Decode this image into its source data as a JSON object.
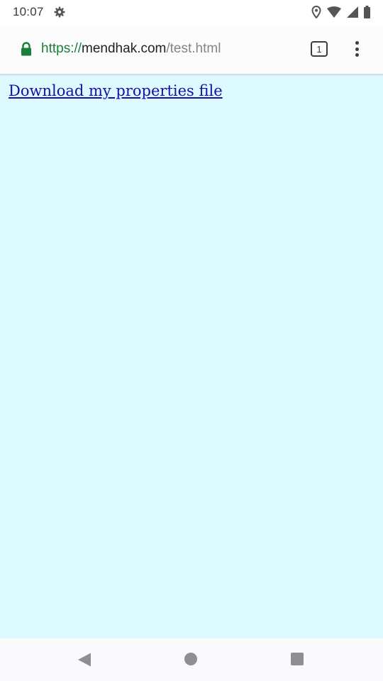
{
  "status_bar": {
    "time": "10:07",
    "icons": [
      "gear-icon",
      "location-icon",
      "wifi-icon",
      "cellular-signal-icon",
      "battery-icon"
    ]
  },
  "toolbar": {
    "url_scheme": "https://",
    "url_host": "mendhak.com",
    "url_path": "/test.html",
    "tab_count": "1",
    "secure_color": "#188038"
  },
  "page": {
    "link_text": "Download my properties file",
    "background_color": "#ddfbff",
    "link_color": "#1a0dab"
  },
  "nav_bar": {
    "icons": [
      "back-icon",
      "home-icon",
      "recents-icon"
    ]
  }
}
